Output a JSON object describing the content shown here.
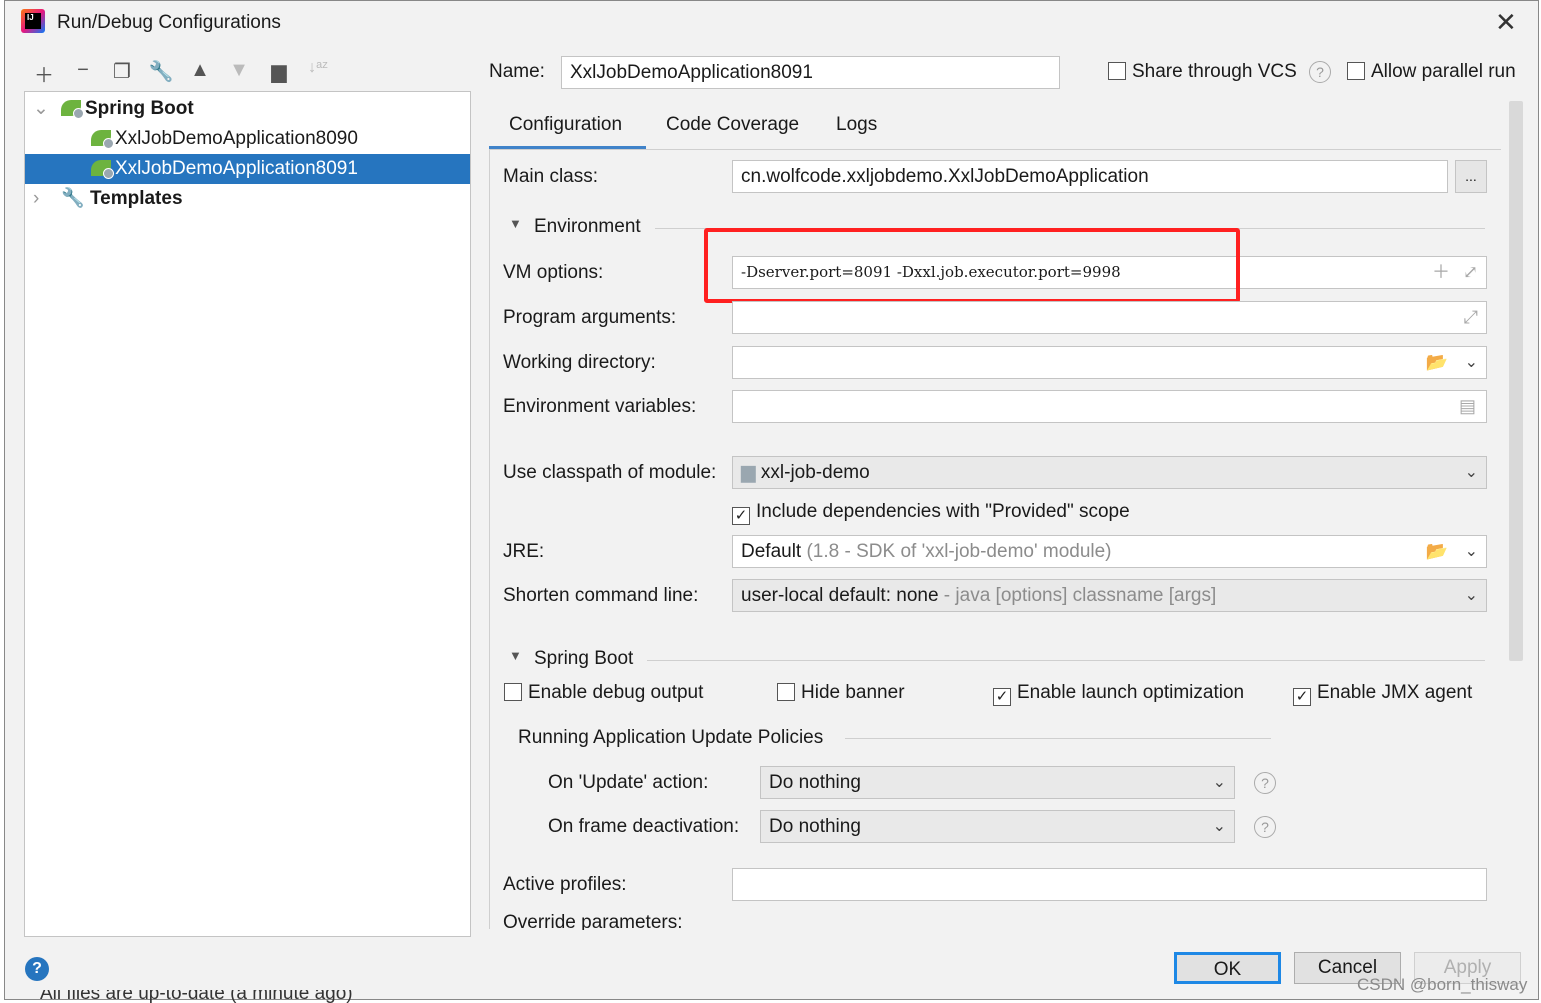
{
  "window": {
    "title": "Run/Debug Configurations",
    "logo_text": "IJ"
  },
  "toolbar": {
    "icons": [
      "plus-icon",
      "minus-icon",
      "copy-icon",
      "wrench-icon",
      "arrow-up-icon",
      "arrow-down-icon",
      "folder-add-icon",
      "sort-az-icon"
    ]
  },
  "tree": {
    "group": "Spring Boot",
    "items": [
      "XxlJobDemoApplication8090",
      "XxlJobDemoApplication8091"
    ],
    "selected": "XxlJobDemoApplication8091",
    "templates": "Templates"
  },
  "header": {
    "name_label": "Name:",
    "name_value": "XxlJobDemoApplication8091",
    "share_vcs": "Share through VCS",
    "share_vcs_checked": false,
    "parallel": "Allow parallel run",
    "parallel_checked": false
  },
  "tabs": [
    "Configuration",
    "Code Coverage",
    "Logs"
  ],
  "active_tab": "Configuration",
  "config": {
    "main_class_label": "Main class:",
    "main_class": "cn.wolfcode.xxljobdemo.XxlJobDemoApplication",
    "browse": "...",
    "environment": "Environment",
    "vm_label": "VM options:",
    "vm_value": "-Dserver.port=8091 -Dxxl.job.executor.port=9998",
    "prog_label": "Program arguments:",
    "prog_value": "",
    "wd_label": "Working directory:",
    "wd_value": "",
    "env_label": "Environment variables:",
    "env_value": "",
    "module_label": "Use classpath of module:",
    "module_value": "xxl-job-demo",
    "include_deps": "Include dependencies with \"Provided\" scope",
    "include_deps_checked": true,
    "jre_label": "JRE:",
    "jre_value": "Default",
    "jre_hint": "(1.8 - SDK of 'xxl-job-demo' module)",
    "shorten_label": "Shorten command line:",
    "shorten_value": "user-local default: none",
    "shorten_hint": "- java [options] classname [args]"
  },
  "spring": {
    "section": "Spring Boot",
    "debug": "Enable debug output",
    "debug_checked": false,
    "banner": "Hide banner",
    "banner_checked": false,
    "launch": "Enable launch optimization",
    "launch_checked": true,
    "jmx": "Enable JMX agent",
    "jmx_checked": true,
    "policies": "Running Application Update Policies",
    "update_label": "On 'Update' action:",
    "update_value": "Do nothing",
    "frame_label": "On frame deactivation:",
    "frame_value": "Do nothing",
    "profiles_label": "Active profiles:",
    "profiles_value": "",
    "override_label": "Override parameters:"
  },
  "buttons": {
    "ok": "OK",
    "cancel": "Cancel",
    "apply": "Apply"
  },
  "status": "All files are up-to-date (a minute ago)",
  "watermark": "CSDN @born_thisway",
  "colors": {
    "selection": "#2675bf",
    "highlight_box": "#ff2020",
    "tab_underline": "#4083c9"
  }
}
